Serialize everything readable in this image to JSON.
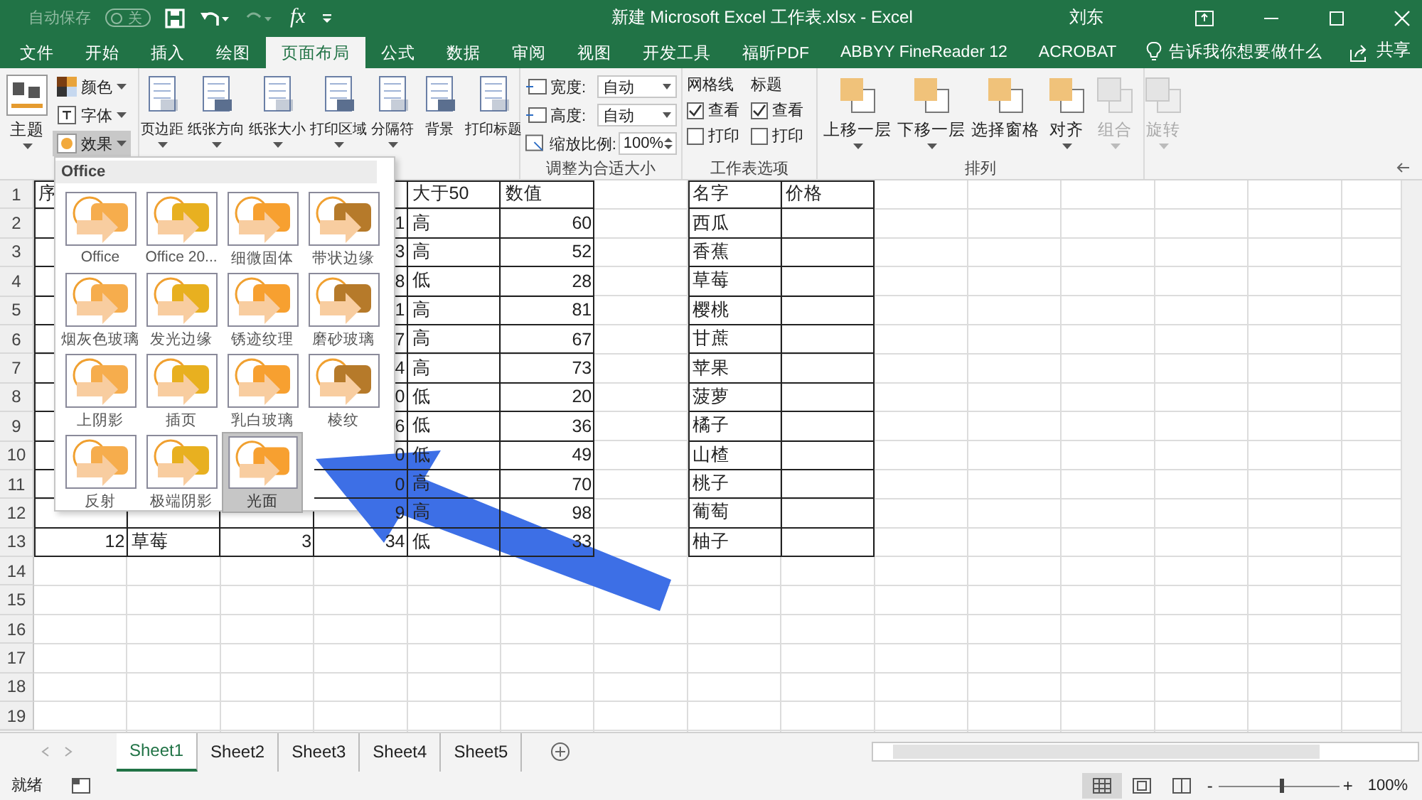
{
  "title_bar": {
    "autosave_label": "自动保存",
    "autosave_toggle": {
      "label": "关",
      "on": false
    },
    "formula_glyph": "fx",
    "title": "新建 Microsoft Excel 工作表.xlsx  -  Excel",
    "user": "刘东"
  },
  "ribbon_tabs": [
    {
      "label": "文件",
      "selected": false
    },
    {
      "label": "开始",
      "selected": false
    },
    {
      "label": "插入",
      "selected": false
    },
    {
      "label": "绘图",
      "selected": false
    },
    {
      "label": "页面布局",
      "selected": true
    },
    {
      "label": "公式",
      "selected": false
    },
    {
      "label": "数据",
      "selected": false
    },
    {
      "label": "审阅",
      "selected": false
    },
    {
      "label": "视图",
      "selected": false
    },
    {
      "label": "开发工具",
      "selected": false
    },
    {
      "label": "福昕PDF",
      "selected": false
    },
    {
      "label": "ABBYY FineReader 12",
      "selected": false
    },
    {
      "label": "ACROBAT",
      "selected": false
    }
  ],
  "tell_me": "告诉我你想要做什么",
  "share": "共享",
  "ribbon": {
    "theme": {
      "label": "主题",
      "items": [
        {
          "label": "颜色",
          "pressed": false
        },
        {
          "label": "字体",
          "pressed": false
        },
        {
          "label": "效果",
          "pressed": true
        }
      ]
    },
    "page_setup": [
      {
        "label": "页边距",
        "menu": true
      },
      {
        "label": "纸张方向",
        "menu": true
      },
      {
        "label": "纸张大小",
        "menu": true
      },
      {
        "label": "打印区域",
        "menu": true
      },
      {
        "label": "分隔符",
        "menu": true
      },
      {
        "label": "背景",
        "menu": false
      },
      {
        "label": "打印标题",
        "menu": false
      }
    ],
    "scale_to_fit": {
      "rows": [
        {
          "label": "宽度:",
          "value": "自动"
        },
        {
          "label": "高度:",
          "value": "自动"
        }
      ],
      "scale_label": "缩放比例:",
      "scale_value": "100%",
      "group_label": "调整为合适大小"
    },
    "sheet_options": {
      "columns": [
        {
          "title": "网格线",
          "view": {
            "label": "查看",
            "checked": true
          },
          "print": {
            "label": "打印",
            "checked": false
          }
        },
        {
          "title": "标题",
          "view": {
            "label": "查看",
            "checked": true
          },
          "print": {
            "label": "打印",
            "checked": false
          }
        }
      ],
      "group_label": "工作表选项"
    },
    "arrange": {
      "buttons": [
        {
          "label": "上移一层",
          "menu": true,
          "disabled": false
        },
        {
          "label": "下移一层",
          "menu": true,
          "disabled": false
        },
        {
          "label": "选择窗格",
          "menu": false,
          "disabled": false
        },
        {
          "label": "对齐",
          "menu": true,
          "disabled": false
        },
        {
          "label": "组合",
          "menu": true,
          "disabled": true
        },
        {
          "label": "旋转",
          "menu": true,
          "disabled": true
        }
      ],
      "group_label": "排列"
    }
  },
  "effects_menu": {
    "header": "Office",
    "items": [
      {
        "label": "Office",
        "selected": false
      },
      {
        "label": "Office 20...",
        "selected": false
      },
      {
        "label": "细微固体",
        "selected": false
      },
      {
        "label": "带状边缘",
        "selected": false
      },
      {
        "label": "烟灰色玻璃",
        "selected": false
      },
      {
        "label": "发光边缘",
        "selected": false
      },
      {
        "label": "锈迹纹理",
        "selected": false
      },
      {
        "label": "磨砂玻璃",
        "selected": false
      },
      {
        "label": "上阴影",
        "selected": false
      },
      {
        "label": "插页",
        "selected": false
      },
      {
        "label": "乳白玻璃",
        "selected": false
      },
      {
        "label": "棱纹",
        "selected": false
      },
      {
        "label": "反射",
        "selected": false
      },
      {
        "label": "极端阴影",
        "selected": false
      },
      {
        "label": "光面",
        "selected": true
      }
    ]
  },
  "sheet": {
    "rows": [
      {
        "number": "1",
        "kind": "header",
        "A": "序",
        "E": "大于50",
        "F": "数值",
        "H": "名字",
        "I": "价格"
      },
      {
        "number": "2",
        "kind": "data",
        "D": "1",
        "E": "高",
        "F": "60",
        "H": "西瓜"
      },
      {
        "number": "3",
        "kind": "data",
        "D": "3",
        "E": "高",
        "F": "52",
        "H": "香蕉"
      },
      {
        "number": "4",
        "kind": "data",
        "D": "8",
        "E": "低",
        "F": "28",
        "H": "草莓"
      },
      {
        "number": "5",
        "kind": "data",
        "D": "1",
        "E": "高",
        "F": "81",
        "H": "樱桃"
      },
      {
        "number": "6",
        "kind": "data",
        "D": "7",
        "E": "高",
        "F": "67",
        "H": "甘蔗"
      },
      {
        "number": "7",
        "kind": "data",
        "D": "4",
        "E": "高",
        "F": "73",
        "H": "苹果"
      },
      {
        "number": "8",
        "kind": "data",
        "D": "0",
        "E": "低",
        "F": "20",
        "H": "菠萝"
      },
      {
        "number": "9",
        "kind": "data",
        "D": "6",
        "E": "低",
        "F": "36",
        "H": "橘子"
      },
      {
        "number": "10",
        "kind": "data",
        "D": "0",
        "E": "低",
        "F": "49",
        "H": "山楂"
      },
      {
        "number": "11",
        "kind": "data",
        "D": "0",
        "E": "高",
        "F": "70",
        "H": "桃子"
      },
      {
        "number": "12",
        "kind": "data",
        "D": "9",
        "E": "高",
        "F": "98",
        "H": "葡萄"
      },
      {
        "number": "13",
        "kind": "data",
        "A": "12",
        "B": "草莓",
        "C": "3",
        "D": "34",
        "E": "低",
        "F": "33",
        "H": "柚子"
      },
      {
        "number": "14",
        "kind": "blank"
      },
      {
        "number": "15",
        "kind": "blank"
      },
      {
        "number": "16",
        "kind": "blank"
      },
      {
        "number": "17",
        "kind": "blank"
      },
      {
        "number": "18",
        "kind": "blank"
      },
      {
        "number": "19",
        "kind": "blank"
      }
    ]
  },
  "sheet_tabs": [
    {
      "label": "Sheet1",
      "selected": true
    },
    {
      "label": "Sheet2",
      "selected": false
    },
    {
      "label": "Sheet3",
      "selected": false
    },
    {
      "label": "Sheet4",
      "selected": false
    },
    {
      "label": "Sheet5",
      "selected": false
    }
  ],
  "status_bar": {
    "text": "就绪",
    "views": [
      {
        "selected": true
      },
      {
        "selected": false
      },
      {
        "selected": false
      }
    ],
    "zoom_out": "-",
    "zoom_in": "+",
    "zoom": {
      "level": 0.52
    },
    "zoom_text": "100%"
  }
}
